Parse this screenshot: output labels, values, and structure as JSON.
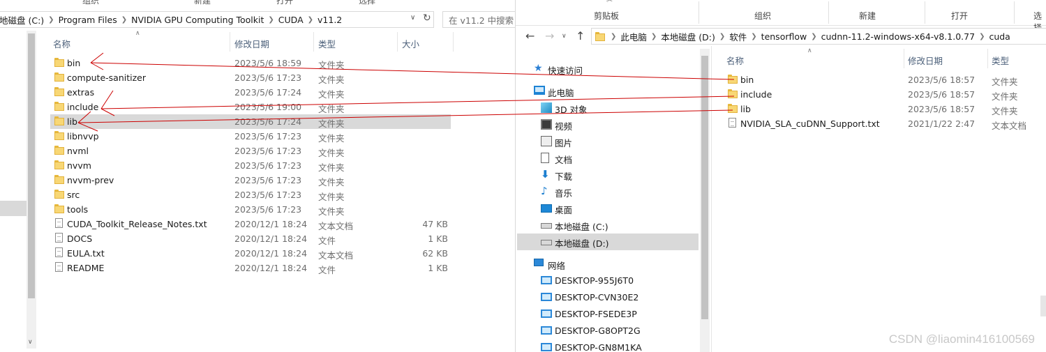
{
  "left": {
    "ribbon": [
      "组织",
      "新建",
      "打开",
      "选择"
    ],
    "address": {
      "crumbs": [
        "地磁盘 (C:)",
        "Program Files",
        "NVIDIA GPU Computing Toolkit",
        "CUDA",
        "v11.2"
      ],
      "search_placeholder": "在 v11.2 中搜索"
    },
    "columns": {
      "name": "名称",
      "date": "修改日期",
      "type": "类型",
      "size": "大小"
    },
    "rows": [
      {
        "name": "bin",
        "date": "2023/5/6 18:59",
        "type": "文件夹",
        "size": "",
        "kind": "folder"
      },
      {
        "name": "compute-sanitizer",
        "date": "2023/5/6 17:23",
        "type": "文件夹",
        "size": "",
        "kind": "folder"
      },
      {
        "name": "extras",
        "date": "2023/5/6 17:24",
        "type": "文件夹",
        "size": "",
        "kind": "folder"
      },
      {
        "name": "include",
        "date": "2023/5/6 19:00",
        "type": "文件夹",
        "size": "",
        "kind": "folder"
      },
      {
        "name": "lib",
        "date": "2023/5/6 17:24",
        "type": "文件夹",
        "size": "",
        "kind": "folder",
        "selected": true
      },
      {
        "name": "libnvvp",
        "date": "2023/5/6 17:23",
        "type": "文件夹",
        "size": "",
        "kind": "folder"
      },
      {
        "name": "nvml",
        "date": "2023/5/6 17:23",
        "type": "文件夹",
        "size": "",
        "kind": "folder"
      },
      {
        "name": "nvvm",
        "date": "2023/5/6 17:23",
        "type": "文件夹",
        "size": "",
        "kind": "folder"
      },
      {
        "name": "nvvm-prev",
        "date": "2023/5/6 17:23",
        "type": "文件夹",
        "size": "",
        "kind": "folder"
      },
      {
        "name": "src",
        "date": "2023/5/6 17:23",
        "type": "文件夹",
        "size": "",
        "kind": "folder"
      },
      {
        "name": "tools",
        "date": "2023/5/6 17:23",
        "type": "文件夹",
        "size": "",
        "kind": "folder"
      },
      {
        "name": "CUDA_Toolkit_Release_Notes.txt",
        "date": "2020/12/1 18:24",
        "type": "文本文档",
        "size": "47 KB",
        "kind": "file"
      },
      {
        "name": "DOCS",
        "date": "2020/12/1 18:24",
        "type": "文件",
        "size": "1 KB",
        "kind": "file"
      },
      {
        "name": "EULA.txt",
        "date": "2020/12/1 18:24",
        "type": "文本文档",
        "size": "62 KB",
        "kind": "file"
      },
      {
        "name": "README",
        "date": "2020/12/1 18:24",
        "type": "文件",
        "size": "1 KB",
        "kind": "file"
      }
    ]
  },
  "right": {
    "ribbon": [
      "剪贴板",
      "组织",
      "新建",
      "打开",
      "选择"
    ],
    "address": {
      "crumbs": [
        "此电脑",
        "本地磁盘 (D:)",
        "软件",
        "tensorflow",
        "cudnn-11.2-windows-x64-v8.1.0.77",
        "cuda"
      ]
    },
    "nav": [
      {
        "label": "快速访问",
        "icon": "star-icon"
      },
      {
        "label": "此电脑",
        "icon": "computer-icon"
      },
      {
        "label": "3D 对象",
        "icon": "3d-objects-icon"
      },
      {
        "label": "视频",
        "icon": "video-icon"
      },
      {
        "label": "图片",
        "icon": "pictures-icon"
      },
      {
        "label": "文档",
        "icon": "documents-icon"
      },
      {
        "label": "下载",
        "icon": "download-icon"
      },
      {
        "label": "音乐",
        "icon": "music-icon"
      },
      {
        "label": "桌面",
        "icon": "desktop-icon"
      },
      {
        "label": "本地磁盘 (C:)",
        "icon": "drive-icon"
      },
      {
        "label": "本地磁盘 (D:)",
        "icon": "drive-icon",
        "selected": true
      },
      {
        "label": "网络",
        "icon": "network-icon"
      },
      {
        "label": "DESKTOP-955J6T0",
        "icon": "monitor-icon"
      },
      {
        "label": "DESKTOP-CVN30E2",
        "icon": "monitor-icon"
      },
      {
        "label": "DESKTOP-FSEDE3P",
        "icon": "monitor-icon"
      },
      {
        "label": "DESKTOP-G8OPT2G",
        "icon": "monitor-icon"
      },
      {
        "label": "DESKTOP-GN8M1KA",
        "icon": "monitor-icon"
      }
    ],
    "columns": {
      "name": "名称",
      "date": "修改日期",
      "type": "类型"
    },
    "rows": [
      {
        "name": "bin",
        "date": "2023/5/6 18:57",
        "type": "文件夹",
        "kind": "folder"
      },
      {
        "name": "include",
        "date": "2023/5/6 18:57",
        "type": "文件夹",
        "kind": "folder"
      },
      {
        "name": "lib",
        "date": "2023/5/6 18:57",
        "type": "文件夹",
        "kind": "folder"
      },
      {
        "name": "NVIDIA_SLA_cuDNN_Support.txt",
        "date": "2021/1/22 2:47",
        "type": "文本文档",
        "kind": "file"
      }
    ]
  },
  "watermark": "CSDN @liaomin416100569",
  "colors": {
    "annotation": "#cc0000",
    "selection": "#d9d9d9",
    "folder": "#f8d775"
  }
}
